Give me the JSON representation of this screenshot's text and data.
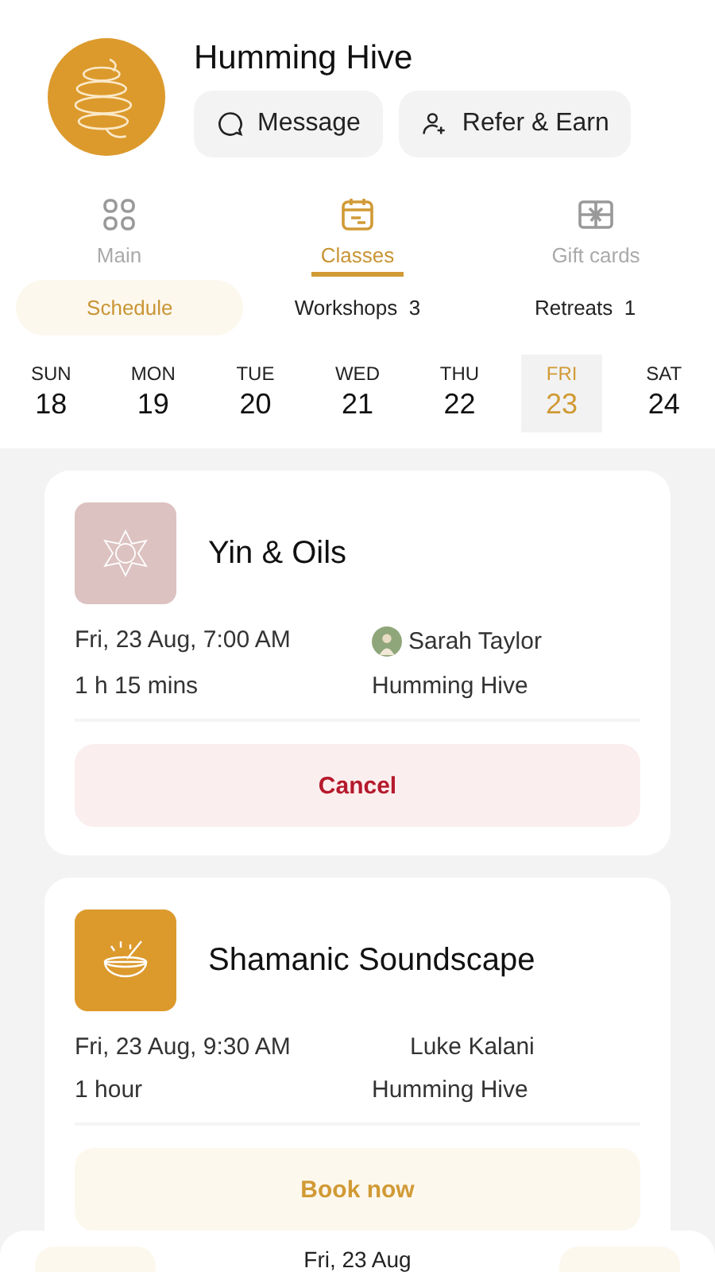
{
  "profile": {
    "name": "Humming Hive",
    "buttons": [
      {
        "kind": "message",
        "label": "Message"
      },
      {
        "kind": "refer",
        "label": "Refer & Earn"
      }
    ]
  },
  "tabs": [
    {
      "kind": "main",
      "label": "Main",
      "selected": false
    },
    {
      "kind": "classes",
      "label": "Classes",
      "selected": true
    },
    {
      "kind": "gifts",
      "label": "Gift cards",
      "selected": false
    }
  ],
  "segments": [
    {
      "label": "Schedule",
      "selected": true
    },
    {
      "label": "Workshops",
      "count": "3",
      "selected": false
    },
    {
      "label": "Retreats",
      "count": "1",
      "selected": false
    }
  ],
  "days": [
    {
      "weekday": "SUN",
      "date": "18",
      "selected": false
    },
    {
      "weekday": "MON",
      "date": "19",
      "selected": false
    },
    {
      "weekday": "TUE",
      "date": "20",
      "selected": false
    },
    {
      "weekday": "WED",
      "date": "21",
      "selected": false
    },
    {
      "weekday": "THU",
      "date": "22",
      "selected": false
    },
    {
      "weekday": "FRI",
      "date": "23",
      "selected": true
    },
    {
      "weekday": "SAT",
      "date": "24",
      "selected": false
    }
  ],
  "classes": [
    {
      "kind": "lotus",
      "title": "Yin & Oils",
      "when": "Fri, 23 Aug, 7:00 AM",
      "duration": "1 h 15 mins",
      "instructor": "Sarah  Taylor",
      "avatar": true,
      "venue": "Humming Hive",
      "action": {
        "kind": "cancel",
        "label": "Cancel"
      }
    },
    {
      "kind": "bowl",
      "title": "Shamanic Soundscape",
      "when": "Fri, 23 Aug, 9:30 AM",
      "duration": "1 hour",
      "instructor": "Luke Kalani",
      "avatar": false,
      "venue": "Humming Hive",
      "action": {
        "kind": "book",
        "label": "Book now"
      }
    }
  ],
  "bottom_sheet": {
    "date": "Fri, 23 Aug"
  }
}
